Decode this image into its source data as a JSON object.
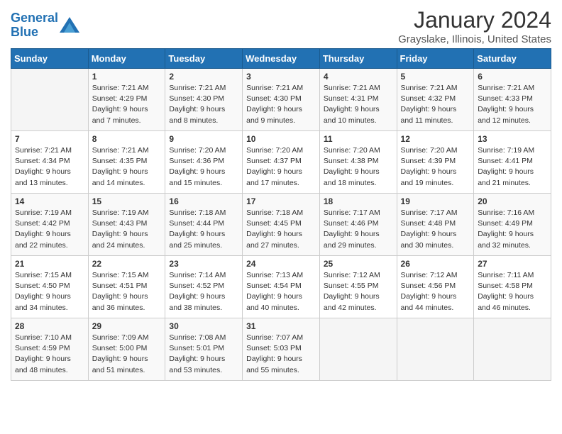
{
  "header": {
    "logo_line1": "General",
    "logo_line2": "Blue",
    "month_title": "January 2024",
    "location": "Grayslake, Illinois, United States"
  },
  "days_of_week": [
    "Sunday",
    "Monday",
    "Tuesday",
    "Wednesday",
    "Thursday",
    "Friday",
    "Saturday"
  ],
  "weeks": [
    [
      {
        "day": "",
        "info": ""
      },
      {
        "day": "1",
        "info": "Sunrise: 7:21 AM\nSunset: 4:29 PM\nDaylight: 9 hours\nand 7 minutes."
      },
      {
        "day": "2",
        "info": "Sunrise: 7:21 AM\nSunset: 4:30 PM\nDaylight: 9 hours\nand 8 minutes."
      },
      {
        "day": "3",
        "info": "Sunrise: 7:21 AM\nSunset: 4:30 PM\nDaylight: 9 hours\nand 9 minutes."
      },
      {
        "day": "4",
        "info": "Sunrise: 7:21 AM\nSunset: 4:31 PM\nDaylight: 9 hours\nand 10 minutes."
      },
      {
        "day": "5",
        "info": "Sunrise: 7:21 AM\nSunset: 4:32 PM\nDaylight: 9 hours\nand 11 minutes."
      },
      {
        "day": "6",
        "info": "Sunrise: 7:21 AM\nSunset: 4:33 PM\nDaylight: 9 hours\nand 12 minutes."
      }
    ],
    [
      {
        "day": "7",
        "info": "Sunrise: 7:21 AM\nSunset: 4:34 PM\nDaylight: 9 hours\nand 13 minutes."
      },
      {
        "day": "8",
        "info": "Sunrise: 7:21 AM\nSunset: 4:35 PM\nDaylight: 9 hours\nand 14 minutes."
      },
      {
        "day": "9",
        "info": "Sunrise: 7:20 AM\nSunset: 4:36 PM\nDaylight: 9 hours\nand 15 minutes."
      },
      {
        "day": "10",
        "info": "Sunrise: 7:20 AM\nSunset: 4:37 PM\nDaylight: 9 hours\nand 17 minutes."
      },
      {
        "day": "11",
        "info": "Sunrise: 7:20 AM\nSunset: 4:38 PM\nDaylight: 9 hours\nand 18 minutes."
      },
      {
        "day": "12",
        "info": "Sunrise: 7:20 AM\nSunset: 4:39 PM\nDaylight: 9 hours\nand 19 minutes."
      },
      {
        "day": "13",
        "info": "Sunrise: 7:19 AM\nSunset: 4:41 PM\nDaylight: 9 hours\nand 21 minutes."
      }
    ],
    [
      {
        "day": "14",
        "info": "Sunrise: 7:19 AM\nSunset: 4:42 PM\nDaylight: 9 hours\nand 22 minutes."
      },
      {
        "day": "15",
        "info": "Sunrise: 7:19 AM\nSunset: 4:43 PM\nDaylight: 9 hours\nand 24 minutes."
      },
      {
        "day": "16",
        "info": "Sunrise: 7:18 AM\nSunset: 4:44 PM\nDaylight: 9 hours\nand 25 minutes."
      },
      {
        "day": "17",
        "info": "Sunrise: 7:18 AM\nSunset: 4:45 PM\nDaylight: 9 hours\nand 27 minutes."
      },
      {
        "day": "18",
        "info": "Sunrise: 7:17 AM\nSunset: 4:46 PM\nDaylight: 9 hours\nand 29 minutes."
      },
      {
        "day": "19",
        "info": "Sunrise: 7:17 AM\nSunset: 4:48 PM\nDaylight: 9 hours\nand 30 minutes."
      },
      {
        "day": "20",
        "info": "Sunrise: 7:16 AM\nSunset: 4:49 PM\nDaylight: 9 hours\nand 32 minutes."
      }
    ],
    [
      {
        "day": "21",
        "info": "Sunrise: 7:15 AM\nSunset: 4:50 PM\nDaylight: 9 hours\nand 34 minutes."
      },
      {
        "day": "22",
        "info": "Sunrise: 7:15 AM\nSunset: 4:51 PM\nDaylight: 9 hours\nand 36 minutes."
      },
      {
        "day": "23",
        "info": "Sunrise: 7:14 AM\nSunset: 4:52 PM\nDaylight: 9 hours\nand 38 minutes."
      },
      {
        "day": "24",
        "info": "Sunrise: 7:13 AM\nSunset: 4:54 PM\nDaylight: 9 hours\nand 40 minutes."
      },
      {
        "day": "25",
        "info": "Sunrise: 7:12 AM\nSunset: 4:55 PM\nDaylight: 9 hours\nand 42 minutes."
      },
      {
        "day": "26",
        "info": "Sunrise: 7:12 AM\nSunset: 4:56 PM\nDaylight: 9 hours\nand 44 minutes."
      },
      {
        "day": "27",
        "info": "Sunrise: 7:11 AM\nSunset: 4:58 PM\nDaylight: 9 hours\nand 46 minutes."
      }
    ],
    [
      {
        "day": "28",
        "info": "Sunrise: 7:10 AM\nSunset: 4:59 PM\nDaylight: 9 hours\nand 48 minutes."
      },
      {
        "day": "29",
        "info": "Sunrise: 7:09 AM\nSunset: 5:00 PM\nDaylight: 9 hours\nand 51 minutes."
      },
      {
        "day": "30",
        "info": "Sunrise: 7:08 AM\nSunset: 5:01 PM\nDaylight: 9 hours\nand 53 minutes."
      },
      {
        "day": "31",
        "info": "Sunrise: 7:07 AM\nSunset: 5:03 PM\nDaylight: 9 hours\nand 55 minutes."
      },
      {
        "day": "",
        "info": ""
      },
      {
        "day": "",
        "info": ""
      },
      {
        "day": "",
        "info": ""
      }
    ]
  ]
}
